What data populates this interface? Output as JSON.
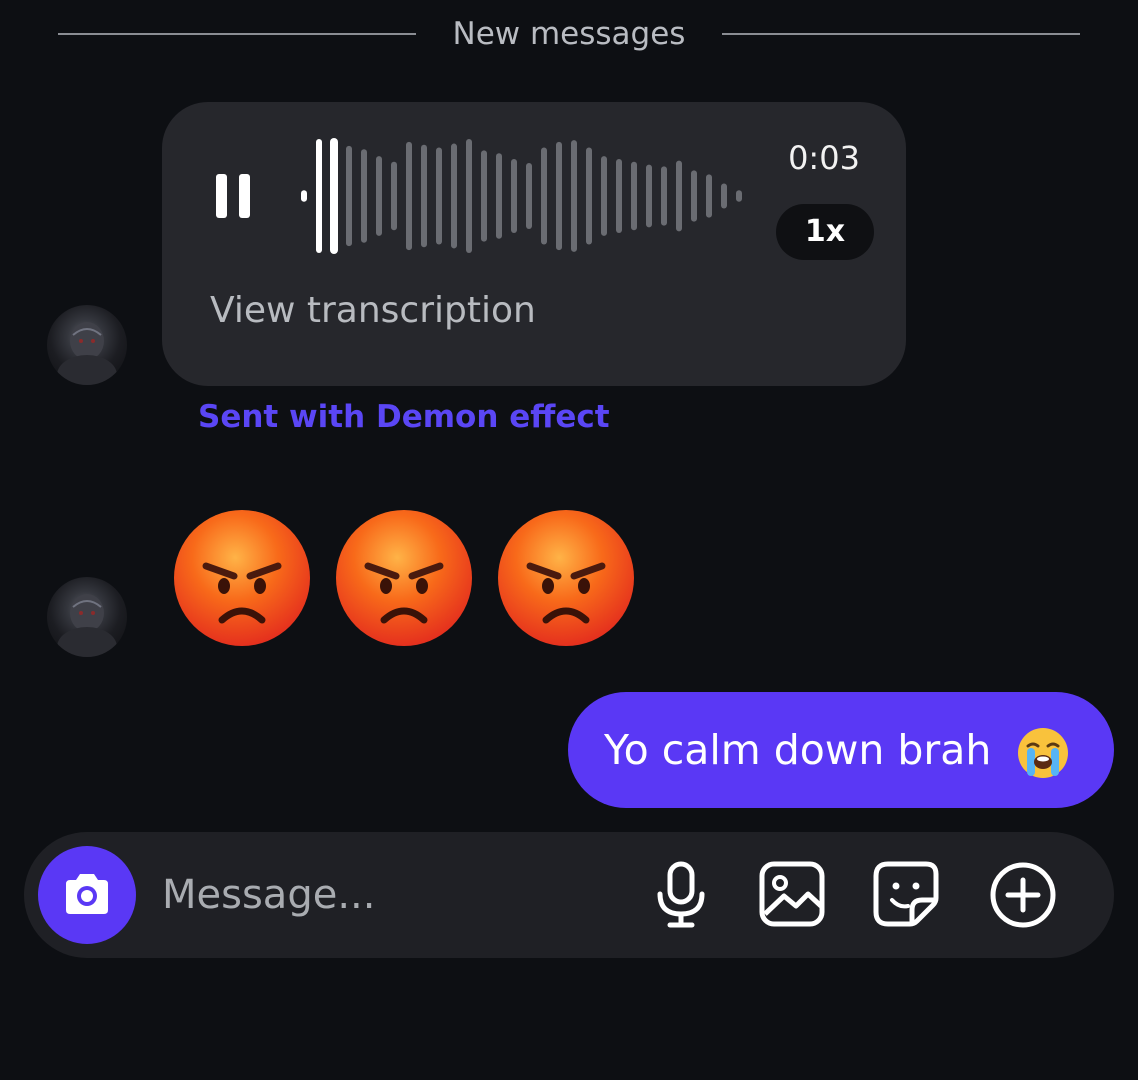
{
  "divider": {
    "label": "New messages"
  },
  "voice_message": {
    "duration": "0:03",
    "speed": "1x",
    "transcription_link": "View transcription",
    "progress": 0.05
  },
  "effect_note": "Sent with Demon effect",
  "emoji_message": {
    "emojis": [
      "angry-face",
      "angry-face",
      "angry-face"
    ]
  },
  "sent_message": {
    "text": "Yo calm down brah",
    "emoji": "loudly-crying-face"
  },
  "composer": {
    "placeholder": "Message...",
    "icons": [
      "camera-icon",
      "microphone-icon",
      "image-icon",
      "sticker-icon",
      "plus-circle-icon"
    ]
  },
  "colors": {
    "accent": "#5a38f5",
    "background": "#0d0f13",
    "bubble": "#26272c"
  }
}
